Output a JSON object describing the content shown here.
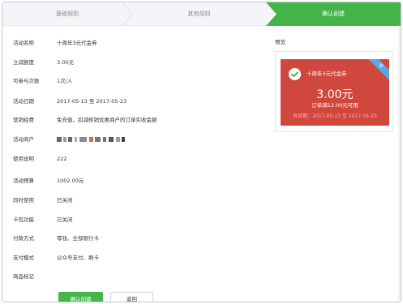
{
  "steps": [
    {
      "label": "基础规则",
      "state": "done"
    },
    {
      "label": "其他规则",
      "state": "done"
    },
    {
      "label": "确认创建",
      "state": "active"
    }
  ],
  "form": {
    "activity_name": {
      "label": "活动名称",
      "value": "十周年3元代金券"
    },
    "reduce_amount": {
      "label": "立减额度",
      "value": "3.00元"
    },
    "participation": {
      "label": "可参与次数",
      "value": "1次/人"
    },
    "activity_date": {
      "label": "活动日期",
      "value": "2017-05-13 至 2017-05-23"
    },
    "marketing_fee": {
      "label": "营销经费",
      "value": "免充值，扣减核销优惠商户的订单实收金额"
    },
    "merchant": {
      "label": "活动商户",
      "value": ""
    },
    "usage_note": {
      "label": "使用说明",
      "value": "222"
    },
    "budget": {
      "label": "活动预算",
      "value": "1002.00元"
    },
    "concurrent_use": {
      "label": "同时使用",
      "value": "已关闭"
    },
    "card_package": {
      "label": "卡包功能",
      "value": "已关闭"
    },
    "payment_method": {
      "label": "付款方式",
      "value": "零钱、全部银行卡"
    },
    "payment_mode": {
      "label": "支付模式",
      "value": "公众号支付、刷卡"
    },
    "product_tag": {
      "label": "商品标记",
      "value": ""
    }
  },
  "buttons": {
    "confirm": "确认创建",
    "back": "返回"
  },
  "preview": {
    "label": "预览",
    "coupon_name": "十周年3元代金券",
    "ribbon": "减",
    "amount": "3.00元",
    "condition": "订单满12.00元可用",
    "validity": "有效期：2017-05-13 至 2017-05-23",
    "card_color": "#d0473d",
    "ribbon_color": "#5aa6e6",
    "logo_icon": "wechat-pay-icon"
  },
  "colors": {
    "accent": "#44b549",
    "step_inactive_bg": "#f4f5f9"
  }
}
